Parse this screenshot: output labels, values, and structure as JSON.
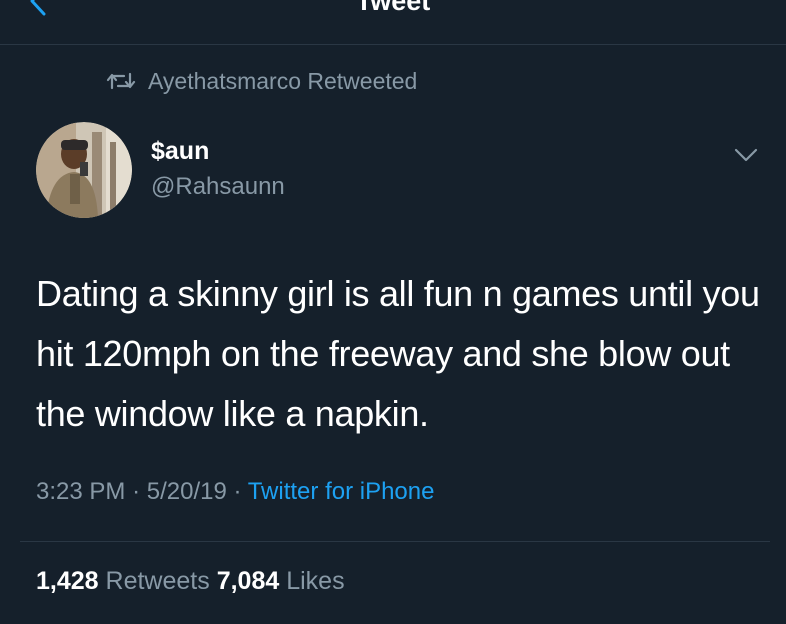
{
  "nav": {
    "title": "Tweet",
    "back_icon": "chevron-left-icon"
  },
  "retweet_context": {
    "icon": "retweet-icon",
    "text": "Ayethatsmarco Retweeted"
  },
  "author": {
    "name": "$aun",
    "handle": "@Rahsaunn",
    "avatar": "avatar-photo"
  },
  "tweet": {
    "text": "Dating a skinny girl is all fun n games until you hit 120mph on the freeway and she blow out the window like a napkin.",
    "time": "3:23 PM",
    "date": "5/20/19",
    "separator": "·",
    "source": "Twitter for iPhone"
  },
  "stats": {
    "retweets_count": "1,428",
    "retweets_label": "Retweets",
    "likes_count": "7,084",
    "likes_label": "Likes"
  },
  "colors": {
    "background": "#15202b",
    "secondary_text": "#8899a6",
    "accent": "#1da1f2"
  }
}
